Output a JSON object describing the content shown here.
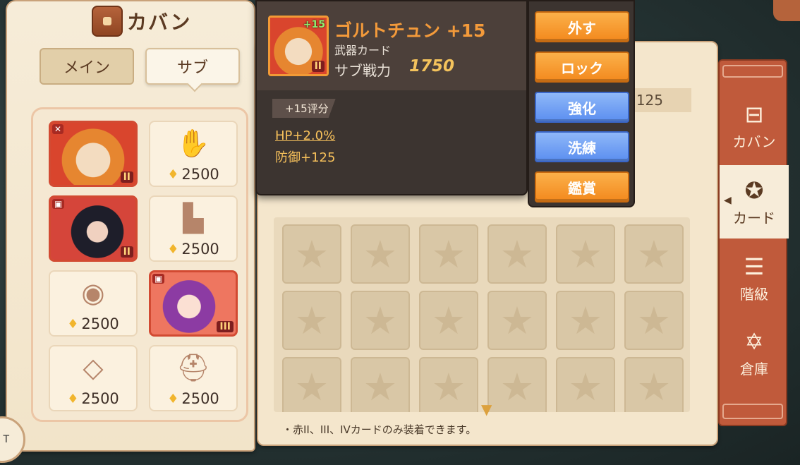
{
  "bag": {
    "title": "カバン",
    "tabs": {
      "main": "メイン",
      "sub": "サブ"
    },
    "slots": [
      {
        "kind": "card",
        "art": "mustache",
        "rank": "II",
        "type_icon": "weapon-icon",
        "selected": true
      },
      {
        "kind": "empty",
        "icon": "glove-icon",
        "price": "2500"
      },
      {
        "kind": "card",
        "art": "boy",
        "rank": "II",
        "type_icon": "armor-icon",
        "selected": false
      },
      {
        "kind": "empty",
        "icon": "pants-icon",
        "price": "2500"
      },
      {
        "kind": "empty",
        "icon": "belt-icon",
        "price": "2500"
      },
      {
        "kind": "card",
        "art": "girl",
        "rank": "III",
        "type_icon": "armor-icon",
        "selected": false
      },
      {
        "kind": "empty",
        "icon": "amulet-icon",
        "price": "2500"
      },
      {
        "kind": "empty",
        "icon": "helmet-icon",
        "price": "2500"
      }
    ]
  },
  "detail": {
    "name": "ゴルトチュン +15",
    "plus": "+15",
    "rank": "II",
    "type": "武器カード",
    "power_label": "サブ戦力",
    "power_value": "1750",
    "score_tag": "+15评分",
    "stats": {
      "hp": "HP+2.0%",
      "def": "防御+125"
    }
  },
  "background_stats": {
    "visible_value": "125"
  },
  "actions": {
    "remove": "外す",
    "lock": "ロック",
    "enhance": "強化",
    "refine": "洗練",
    "view": "鑑賞"
  },
  "side_tabs": {
    "bag": "カバン",
    "card": "カード",
    "rank": "階級",
    "storage": "倉庫"
  },
  "note": "・赤II、III、IVカードのみ装着できます。",
  "coin_label": "T",
  "colors": {
    "accent_orange": "#f3891d",
    "accent_blue": "#5b8ef0",
    "rank_red": "#d24a32",
    "tab_red": "#c05a3b",
    "stat_gold": "#f7c15b"
  }
}
